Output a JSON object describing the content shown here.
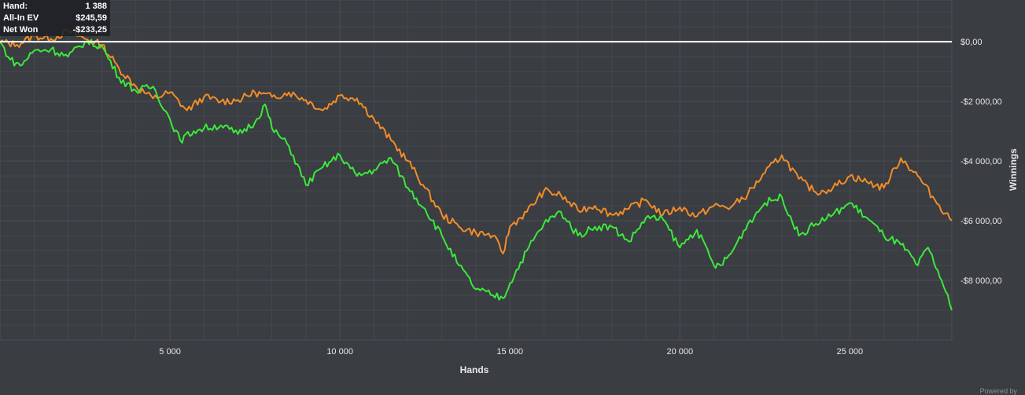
{
  "tooltip": {
    "hand_label": "Hand:",
    "hand_value": "1 388",
    "ev_label": "All-In EV",
    "ev_value": "$245,59",
    "net_label": "Net Won",
    "net_value": "-$233,25"
  },
  "footer": {
    "powered_by": "Powered by"
  },
  "chart_data": {
    "type": "line",
    "xlabel": "Hands",
    "ylabel": "Winnings",
    "xlim": [
      0,
      28000
    ],
    "ylim": [
      -10000,
      1400
    ],
    "x_ticks": [
      5000,
      10000,
      15000,
      20000,
      25000
    ],
    "x_tick_labels": [
      "5 000",
      "10 000",
      "15 000",
      "20 000",
      "25 000"
    ],
    "y_ticks": [
      0,
      -2000,
      -4000,
      -6000,
      -8000
    ],
    "y_tick_labels": [
      "$0,00",
      "-$2 000,00",
      "-$4 000,00",
      "-$6 000,00",
      "-$8 000,00"
    ],
    "grid": true,
    "zero_line": true,
    "colors": {
      "background": "#3a3d42",
      "grid": "#4c5056",
      "zero_line": "#ffffff",
      "axis_text": "#e8e8e8"
    },
    "series": [
      {
        "color": "#f28c28",
        "x": [
          0,
          500,
          1000,
          1500,
          2000,
          2500,
          3000,
          3500,
          4000,
          4500,
          5000,
          5500,
          6000,
          6500,
          7000,
          7500,
          8000,
          8500,
          9000,
          9500,
          10000,
          10500,
          11000,
          11500,
          12000,
          12500,
          13000,
          13500,
          14000,
          14500,
          14800,
          15000,
          15500,
          16000,
          16500,
          17000,
          17500,
          18000,
          18500,
          19000,
          19500,
          20000,
          20500,
          21000,
          21500,
          22000,
          22500,
          23000,
          23500,
          24000,
          24500,
          25000,
          25500,
          26000,
          26500,
          27000,
          27500,
          28000
        ],
        "y": [
          0,
          -100,
          200,
          100,
          350,
          100,
          -100,
          -900,
          -1500,
          -1900,
          -1700,
          -2300,
          -1850,
          -2000,
          -1950,
          -1700,
          -1850,
          -1700,
          -1950,
          -2300,
          -1800,
          -1900,
          -2600,
          -3300,
          -4000,
          -4900,
          -5800,
          -6200,
          -6400,
          -6500,
          -7100,
          -6200,
          -5700,
          -5000,
          -5150,
          -5650,
          -5500,
          -5800,
          -5600,
          -5300,
          -5800,
          -5550,
          -5850,
          -5500,
          -5550,
          -5100,
          -4400,
          -3800,
          -4600,
          -5050,
          -4900,
          -4500,
          -4700,
          -4900,
          -3900,
          -4500,
          -5300,
          -6000
        ]
      },
      {
        "color": "#3ce83c",
        "x": [
          0,
          300,
          600,
          1000,
          1500,
          2000,
          2500,
          3000,
          3500,
          4000,
          4500,
          5000,
          5300,
          5700,
          6000,
          6500,
          7000,
          7500,
          7800,
          8000,
          8500,
          9000,
          9500,
          10000,
          10500,
          11000,
          11500,
          12000,
          12500,
          13000,
          13500,
          14000,
          14500,
          14800,
          15000,
          15500,
          16000,
          16500,
          17000,
          17500,
          18000,
          18500,
          19000,
          19500,
          20000,
          20500,
          21000,
          21200,
          21500,
          22000,
          22500,
          23000,
          23500,
          24000,
          24500,
          25000,
          25500,
          26000,
          26500,
          27000,
          27300,
          27700,
          28000
        ],
        "y": [
          0,
          -600,
          -800,
          -300,
          -250,
          -500,
          0,
          -150,
          -1200,
          -1650,
          -1500,
          -2600,
          -3300,
          -3000,
          -2900,
          -2800,
          -3100,
          -2700,
          -2100,
          -2900,
          -3500,
          -4800,
          -4200,
          -3800,
          -4500,
          -4300,
          -3900,
          -4900,
          -5600,
          -6500,
          -7500,
          -8300,
          -8500,
          -8600,
          -8100,
          -7000,
          -6100,
          -5700,
          -6500,
          -6200,
          -6200,
          -6700,
          -5900,
          -5950,
          -6900,
          -6300,
          -7500,
          -7500,
          -7100,
          -6100,
          -5400,
          -5200,
          -6500,
          -6100,
          -5800,
          -5400,
          -5900,
          -6500,
          -6800,
          -7500,
          -6900,
          -8000,
          -9000
        ]
      }
    ]
  }
}
